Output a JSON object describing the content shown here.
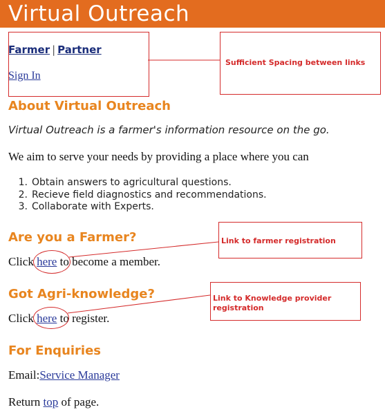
{
  "header": {
    "title": "Virtual Outreach"
  },
  "nav": {
    "farmer": "Farmer",
    "separator": "|",
    "partner": "Partner",
    "sign_in": "Sign In"
  },
  "about": {
    "heading": "About Virtual Outreach",
    "tagline": "Virtual Outreach is a farmer's information resource on the go.",
    "intro": "We aim to serve your needs by providing a place where you can",
    "steps": [
      {
        "num": "1.",
        "text": "Obtain answers to agricultural questions."
      },
      {
        "num": "2.",
        "text": "Recieve field diagnostics and recommendations."
      },
      {
        "num": "3.",
        "text": "Collaborate with Experts."
      }
    ]
  },
  "farmer_section": {
    "heading": "Are you a Farmer?",
    "prefix": "Click",
    "link": "here",
    "suffix": "to become a member."
  },
  "knowledge_section": {
    "heading": "Got Agri-knowledge?",
    "prefix": "Click",
    "link": "here",
    "suffix": "to register."
  },
  "enquiries": {
    "heading": "For Enquiries",
    "email_label": "Email:",
    "email_link": "Service Manager"
  },
  "footer": {
    "prefix": "Return",
    "link": "top",
    "suffix": "of page."
  },
  "annotations": {
    "spacing": "Sufficient Spacing between links",
    "farmer_reg": "Link to farmer registration",
    "knowledge_reg": "Link to Knowledge provider registration"
  },
  "colors": {
    "banner": "#e36c1f",
    "heading": "#e8851f",
    "annotation": "#d42a2a",
    "link": "#2a3a9a"
  }
}
